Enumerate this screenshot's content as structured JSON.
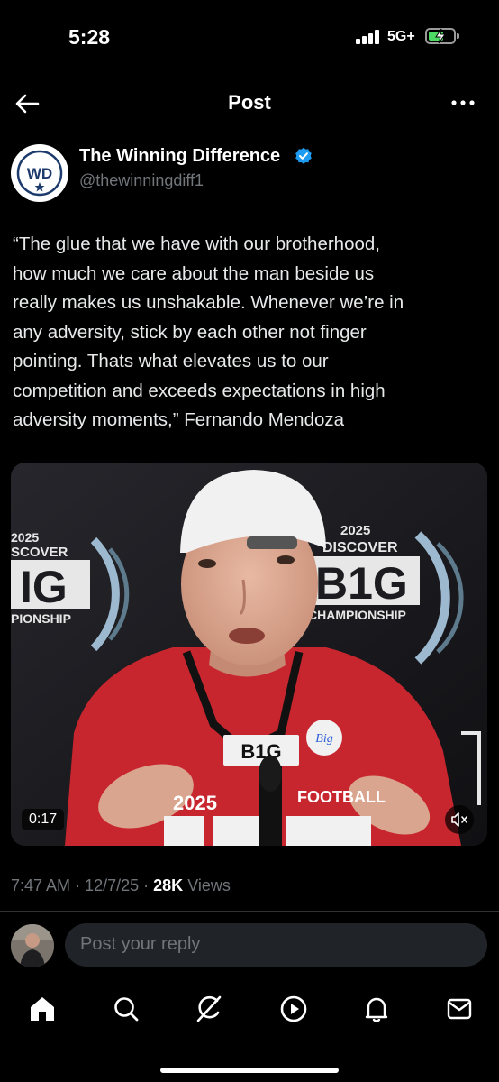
{
  "status_bar": {
    "time": "5:28",
    "network": "5G+"
  },
  "header": {
    "title": "Post"
  },
  "author": {
    "name": "The Winning Difference",
    "handle": "@thewinningdiff1",
    "avatar_text": "WD",
    "verified_color": "#1d9bf0"
  },
  "post": {
    "lines": [
      "“The glue that we have with our brotherhood,",
      "how much we care about the man beside us",
      "really makes us unshakable. Whenever we’re in",
      "any adversity, stick by each other not finger",
      "pointing. Thats what elevates us to our",
      "competition and exceeds expectations in high",
      "adversity moments,” Fernando Mendoza"
    ]
  },
  "video": {
    "duration": "0:17",
    "backdrop_left": {
      "year": "2025",
      "brand": "SCOVER",
      "logo": "IG",
      "label": "PIONSHIP"
    },
    "backdrop_right": {
      "year": "2025",
      "brand": "DISCOVER",
      "logo": "B1G",
      "label": "CHAMPIONSHIP"
    },
    "mic_flag": "B1G",
    "shirt_left": "2025",
    "shirt_right": "FOOTBALL",
    "patch": "Big"
  },
  "meta": {
    "time": "7:47 AM",
    "date": "12/7/25",
    "views_count": "28K",
    "views_label": "Views"
  },
  "reply": {
    "placeholder": "Post your reply"
  },
  "tabs": [
    "home-icon",
    "search-icon",
    "grok-icon",
    "play-icon",
    "bell-icon",
    "mail-icon"
  ]
}
